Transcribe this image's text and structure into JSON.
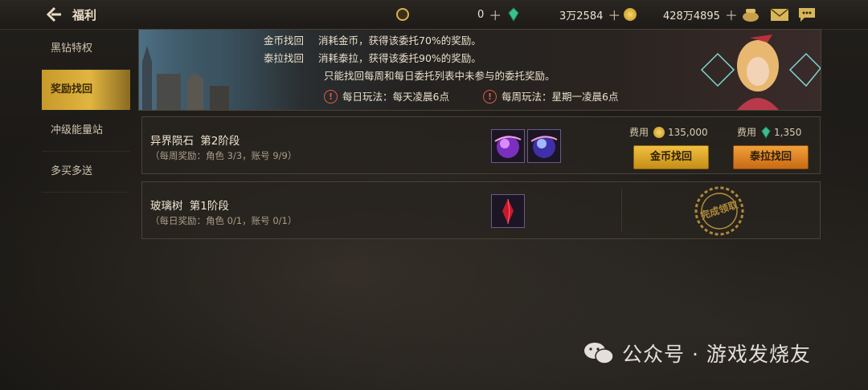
{
  "header": {
    "title": "福利",
    "currencies": [
      {
        "name": "coupon",
        "value": "0"
      },
      {
        "name": "tera",
        "value": "3万2584"
      },
      {
        "name": "gold",
        "value": "428万4895"
      }
    ]
  },
  "sidebar": {
    "items": [
      {
        "label": "黑钻特权",
        "active": false
      },
      {
        "label": "奖励找回",
        "active": true
      },
      {
        "label": "冲级能量站",
        "active": false
      },
      {
        "label": "多买多送",
        "active": false
      }
    ]
  },
  "banner": {
    "lines": [
      {
        "key": "金币找回",
        "text": "消耗金币，获得该委托70%的奖励。"
      },
      {
        "key": "泰拉找回",
        "text": "消耗泰拉，获得该委托90%的奖励。"
      }
    ],
    "note": "只能找回每周和每日委托列表中未参与的委托奖励。",
    "daily": "每日玩法：每天凌晨6点",
    "weekly": "每周玩法：星期一凌晨6点"
  },
  "entries": [
    {
      "title": "异界陨石",
      "stage": "第2阶段",
      "sub": "（每周奖励：角色 3/3，账号 9/9）",
      "gold_cost_label": "费用",
      "gold_cost": "135,000",
      "tera_cost_label": "费用",
      "tera_cost": "1,350",
      "gold_button": "金币找回",
      "tera_button": "泰拉找回"
    },
    {
      "title": "玻璃树",
      "stage": "第1阶段",
      "sub": "（每日奖励：角色 0/1，账号 0/1）",
      "stamp": "完成领取"
    }
  ],
  "watermark": "公众号 · 游戏发烧友",
  "colors": {
    "accent_gold": "#e1b540",
    "button_orange": "#c96a14",
    "warning_red": "#e0574a"
  }
}
